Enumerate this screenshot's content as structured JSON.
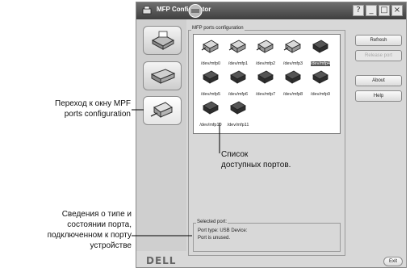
{
  "window": {
    "title": "MFP Configurator",
    "buttons": [
      "?",
      "_",
      "□",
      "×"
    ]
  },
  "leftnav": [
    {
      "icon": "printer-icon"
    },
    {
      "icon": "scanner-icon"
    },
    {
      "icon": "port-connector-icon"
    }
  ],
  "ports_group": {
    "label": "MFP ports configuration",
    "ports": [
      {
        "label": "/dev/mfp0",
        "icon": "parallel-port-icon",
        "selected": false
      },
      {
        "label": "/dev/mfp1",
        "icon": "parallel-port-icon",
        "selected": false
      },
      {
        "label": "/dev/mfp2",
        "icon": "parallel-port-icon",
        "selected": false
      },
      {
        "label": "/dev/mfp3",
        "icon": "parallel-port-icon",
        "selected": false
      },
      {
        "label": "/dev/mfp4",
        "icon": "usb-port-icon",
        "selected": true
      },
      {
        "label": "/dev/mfp5",
        "icon": "usb-port-icon",
        "selected": false
      },
      {
        "label": "/dev/mfp6",
        "icon": "usb-port-icon",
        "selected": false
      },
      {
        "label": "/dev/mfp7",
        "icon": "usb-port-icon",
        "selected": false
      },
      {
        "label": "/dev/mfp8",
        "icon": "usb-port-icon",
        "selected": false
      },
      {
        "label": "/dev/mfp9",
        "icon": "usb-port-icon",
        "selected": false
      },
      {
        "label": "/dev/mfp10",
        "icon": "usb-port-icon",
        "selected": false
      },
      {
        "label": "/dev/mfp11",
        "icon": "usb-port-icon",
        "selected": false
      }
    ]
  },
  "selected_port": {
    "title": "Selected port:",
    "line1": "Port type: USB   Device:",
    "line2": "Port is unused."
  },
  "right_buttons": {
    "refresh": "Refresh",
    "release_port": "Release port",
    "about": "About",
    "help": "Help"
  },
  "footer": {
    "logo": "DELL",
    "exit": "Exit"
  },
  "callouts": {
    "ports_config": [
      "Переход к окну MPF",
      "ports configuration"
    ],
    "port_list": [
      "Список",
      "доступных портов."
    ],
    "port_info": [
      "Сведения о типе и",
      "состоянии порта,",
      "подключенном к порту",
      "устройстве"
    ]
  },
  "colors": {
    "title_bar": "#4f4f4f",
    "selection": "#555555"
  }
}
